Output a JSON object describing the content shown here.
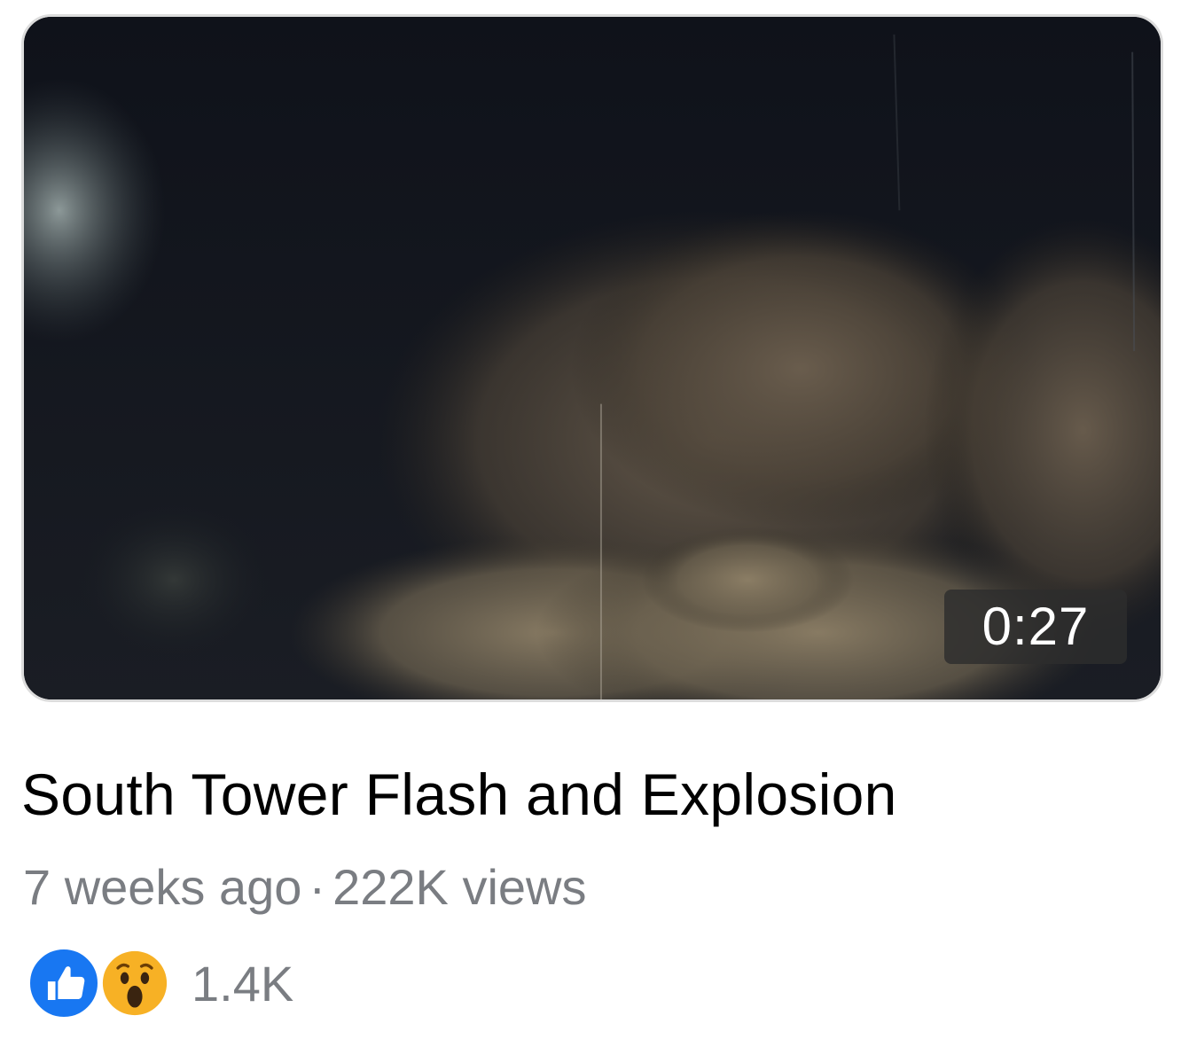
{
  "video": {
    "duration": "0:27",
    "title": "South Tower Flash and Explosion",
    "posted": "7 weeks ago",
    "separator": "·",
    "views": "222K views"
  },
  "reactions": {
    "icons": [
      "like-icon",
      "wow-icon"
    ],
    "count": "1.4K",
    "like_color": "#1877f2",
    "wow_color": "#f7b125"
  }
}
